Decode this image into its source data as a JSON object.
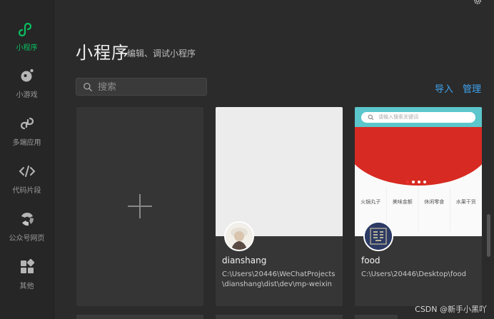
{
  "sidebar": {
    "items": [
      {
        "label": "小程序",
        "icon": "miniprogram-icon",
        "active": true
      },
      {
        "label": "小游戏",
        "icon": "minigame-icon",
        "active": false
      },
      {
        "label": "多端应用",
        "icon": "multi-platform-icon",
        "active": false
      },
      {
        "label": "代码片段",
        "icon": "code-snippet-icon",
        "active": false
      },
      {
        "label": "公众号网页",
        "icon": "official-account-icon",
        "active": false
      },
      {
        "label": "其他",
        "icon": "others-grid-icon",
        "active": false
      }
    ]
  },
  "header": {
    "title": "小程序",
    "subtitle": "编辑、调试小程序",
    "search_placeholder": "搜索",
    "import_label": "导入",
    "manage_label": "管理"
  },
  "projects": [
    {
      "name": "dianshang",
      "path": "C:\\Users\\20446\\WeChatProjects\\dianshang\\dist\\dev\\mp-weixin"
    },
    {
      "name": "food",
      "path": "C:\\Users\\20446\\Desktop\\food",
      "thumbnail": {
        "search_placeholder": "请输入搜索关键词",
        "categories": [
          "火锅丸子",
          "美味金额",
          "休闲零食",
          "水果干货"
        ]
      }
    }
  ],
  "watermark": "CSDN @新手小黑吖",
  "colors": {
    "accent_green": "#07c160",
    "link_blue": "#3ea4f0",
    "background": "#2b2b2b",
    "sidebar": "#262626"
  }
}
